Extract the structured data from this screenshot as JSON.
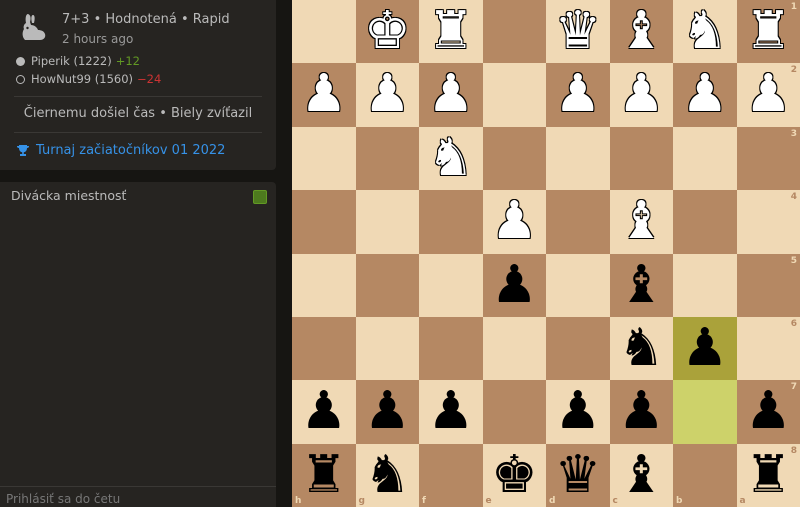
{
  "game": {
    "setup": "7+3 • Hodnotená • Rapid",
    "time_ago": "2 hours ago",
    "white_player": "Piperik (1222)",
    "white_diff": "+12",
    "black_player": "HowNut99 (1560)",
    "black_diff": "−24",
    "status": "Čiernemu došiel čas • Biely zvíťazil",
    "tournament": "Turnaj začiatočníkov 01 2022"
  },
  "chat": {
    "title": "Divácka miestnosť",
    "input_placeholder": "Prihlásiť sa do četu"
  },
  "board": {
    "orientation": "black",
    "files": [
      "h",
      "g",
      "f",
      "e",
      "d",
      "c",
      "b",
      "a"
    ],
    "ranks": [
      "1",
      "2",
      "3",
      "4",
      "5",
      "6",
      "7",
      "8"
    ],
    "highlight": [
      "b7",
      "b6"
    ],
    "pieces": [
      {
        "sq": "g1",
        "p": "K"
      },
      {
        "sq": "f1",
        "p": "R"
      },
      {
        "sq": "d1",
        "p": "Q"
      },
      {
        "sq": "c1",
        "p": "B"
      },
      {
        "sq": "b1",
        "p": "N"
      },
      {
        "sq": "a1",
        "p": "R"
      },
      {
        "sq": "h2",
        "p": "P"
      },
      {
        "sq": "g2",
        "p": "P"
      },
      {
        "sq": "f2",
        "p": "P"
      },
      {
        "sq": "d2",
        "p": "P"
      },
      {
        "sq": "c2",
        "p": "P"
      },
      {
        "sq": "b2",
        "p": "P"
      },
      {
        "sq": "a2",
        "p": "P"
      },
      {
        "sq": "f3",
        "p": "N"
      },
      {
        "sq": "e4",
        "p": "P"
      },
      {
        "sq": "c4",
        "p": "B"
      },
      {
        "sq": "e5",
        "p": "p"
      },
      {
        "sq": "c5",
        "p": "b"
      },
      {
        "sq": "c6",
        "p": "n"
      },
      {
        "sq": "b6",
        "p": "p"
      },
      {
        "sq": "h7",
        "p": "p"
      },
      {
        "sq": "g7",
        "p": "p"
      },
      {
        "sq": "f7",
        "p": "p"
      },
      {
        "sq": "d7",
        "p": "p"
      },
      {
        "sq": "c7",
        "p": "p"
      },
      {
        "sq": "a7",
        "p": "p"
      },
      {
        "sq": "h8",
        "p": "r"
      },
      {
        "sq": "g8",
        "p": "n"
      },
      {
        "sq": "e8",
        "p": "k"
      },
      {
        "sq": "d8",
        "p": "q"
      },
      {
        "sq": "c8",
        "p": "b"
      },
      {
        "sq": "a8",
        "p": "r"
      }
    ]
  },
  "colors": {
    "light_square": "#f0d9b5",
    "dark_square": "#b58863",
    "highlight_light": "#cdd26a",
    "highlight_dark": "#aaa23a",
    "link": "#3692e7",
    "rating_up": "#629924",
    "rating_down": "#cc3333"
  },
  "icons": {
    "speed": "rabbit-icon",
    "tournament": "trophy-icon"
  }
}
